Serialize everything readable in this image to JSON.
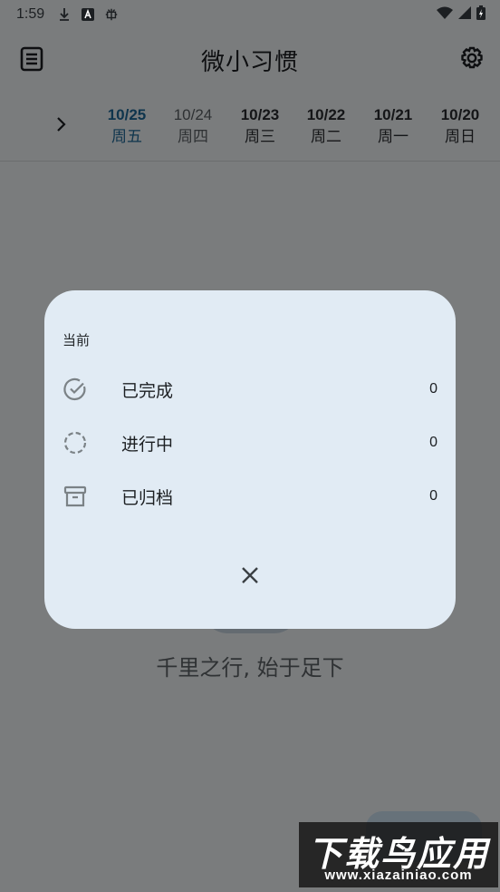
{
  "status_bar": {
    "time": "1:59"
  },
  "app_bar": {
    "title": "微小习惯"
  },
  "dates": [
    {
      "date": "10/25",
      "weekday": "周五"
    },
    {
      "date": "10/24",
      "weekday": "周四"
    },
    {
      "date": "10/23",
      "weekday": "周三"
    },
    {
      "date": "10/22",
      "weekday": "周二"
    },
    {
      "date": "10/21",
      "weekday": "周一"
    },
    {
      "date": "10/20",
      "weekday": "周日"
    }
  ],
  "motto": "千里之行, 始于足下",
  "dialog": {
    "section": "当前",
    "items": [
      {
        "label": "已完成",
        "count": "0",
        "icon": "check-circle-icon"
      },
      {
        "label": "进行中",
        "count": "0",
        "icon": "dashed-circle-icon"
      },
      {
        "label": "已归档",
        "count": "0",
        "icon": "archive-icon"
      }
    ]
  },
  "watermark": {
    "title": "下载鸟应用",
    "url": "www.xiazainiao.com"
  },
  "colors": {
    "accent": "#1f6a9a",
    "dialog_bg": "#e1ebf4"
  }
}
